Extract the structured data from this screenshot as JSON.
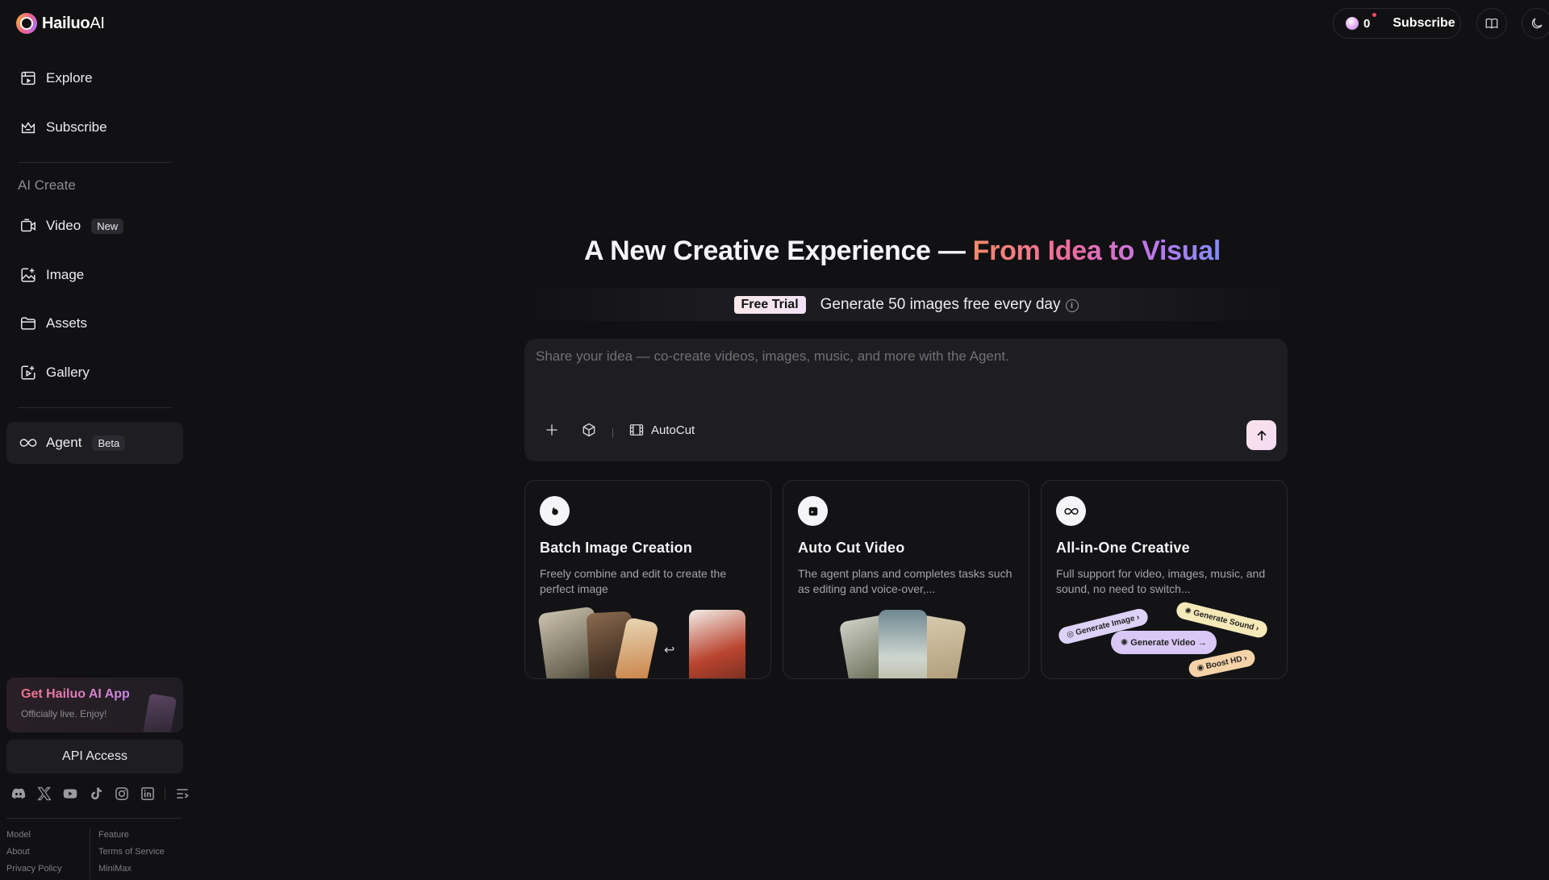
{
  "brand": {
    "name": "Hailuo",
    "suffix": "AI"
  },
  "sidebar": {
    "top_items": [
      {
        "label": "Explore",
        "icon": "explore-icon"
      },
      {
        "label": "Subscribe",
        "icon": "crown-icon"
      }
    ],
    "section_label": "AI Create",
    "create_items": [
      {
        "label": "Video",
        "badge": "New",
        "icon": "video-icon"
      },
      {
        "label": "Image",
        "icon": "image-icon"
      },
      {
        "label": "Assets",
        "icon": "folder-icon"
      },
      {
        "label": "Gallery",
        "icon": "gallery-icon"
      }
    ],
    "agent": {
      "label": "Agent",
      "badge": "Beta",
      "icon": "infinity-icon"
    },
    "app_promo": {
      "title": "Get Hailuo AI App",
      "subtitle": "Officially live. Enjoy!"
    },
    "api_access": "API Access",
    "socials": [
      "discord-icon",
      "x-icon",
      "youtube-icon",
      "tiktok-icon",
      "instagram-icon",
      "linkedin-icon",
      "menu-icon"
    ],
    "footer_links": {
      "col1": [
        "Model",
        "About",
        "Privacy Policy"
      ],
      "col2": [
        "Feature",
        "Terms of Service",
        "MiniMax"
      ]
    }
  },
  "header": {
    "credits": "0",
    "subscribe": "Subscribe"
  },
  "main": {
    "headline_plain": "A New Creative Experience — ",
    "headline_gradient": "From Idea to Visual",
    "trial_badge": "Free Trial",
    "trial_text": "Generate 50 images free every day",
    "prompt_placeholder": "Share your idea — co-create videos, images, music, and more with the Agent.",
    "autocut_label": "AutoCut",
    "cards": [
      {
        "title": "Batch Image Creation",
        "desc": "Freely combine and edit to create the perfect image"
      },
      {
        "title": "Auto Cut Video",
        "desc": "The agent plans and completes tasks such as editing and voice-over,..."
      },
      {
        "title": "All-in-One Creative",
        "desc": "Full support for video, images, music, and sound, no need to switch..."
      }
    ],
    "card3_pills": {
      "generate_image": "Generate Image",
      "generate_sound": "Generate Sound",
      "generate_video": "Generate Video",
      "boost_hd": "Boost HD"
    }
  },
  "colors": {
    "background": "#111113",
    "panel": "#1e1e22",
    "accent_pink": "#ef6aa2",
    "accent_violet": "#7f8cf7"
  }
}
